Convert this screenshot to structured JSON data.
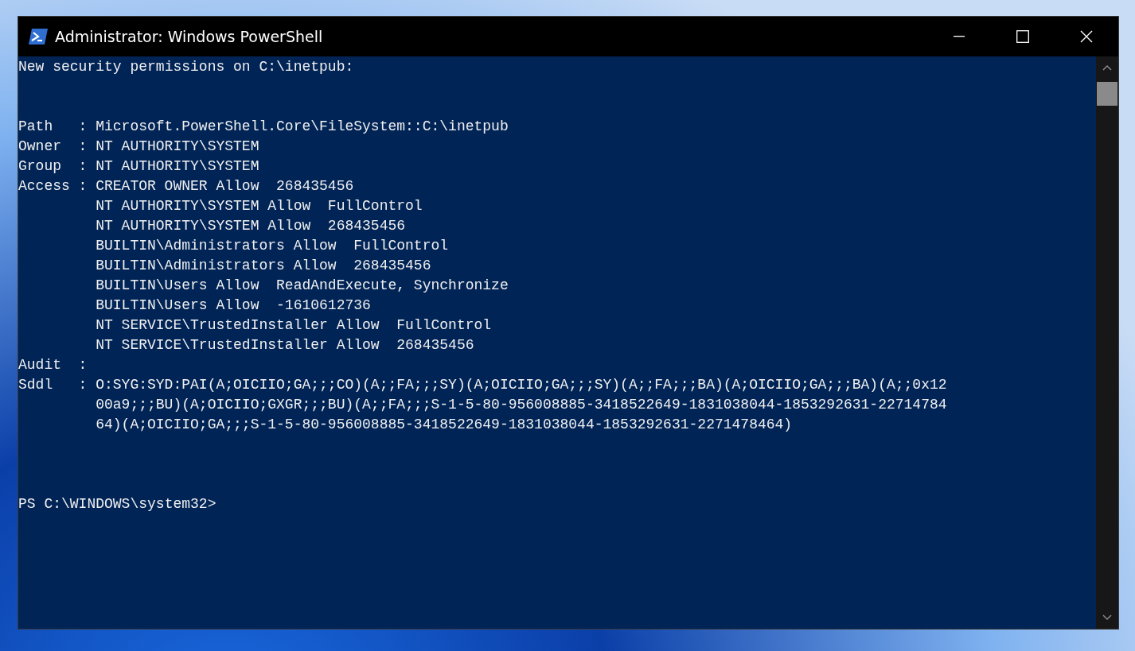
{
  "window": {
    "title": "Administrator: Windows PowerShell"
  },
  "console": {
    "heading": "New security permissions on C:\\inetpub:",
    "fields": [
      {
        "label": "Path   :",
        "lines": [
          "Microsoft.PowerShell.Core\\FileSystem::C:\\inetpub"
        ]
      },
      {
        "label": "Owner  :",
        "lines": [
          "NT AUTHORITY\\SYSTEM"
        ]
      },
      {
        "label": "Group  :",
        "lines": [
          "NT AUTHORITY\\SYSTEM"
        ]
      },
      {
        "label": "Access :",
        "lines": [
          "CREATOR OWNER Allow  268435456",
          "NT AUTHORITY\\SYSTEM Allow  FullControl",
          "NT AUTHORITY\\SYSTEM Allow  268435456",
          "BUILTIN\\Administrators Allow  FullControl",
          "BUILTIN\\Administrators Allow  268435456",
          "BUILTIN\\Users Allow  ReadAndExecute, Synchronize",
          "BUILTIN\\Users Allow  -1610612736",
          "NT SERVICE\\TrustedInstaller Allow  FullControl",
          "NT SERVICE\\TrustedInstaller Allow  268435456"
        ]
      },
      {
        "label": "Audit  :"
      },
      {
        "label": "Sddl   :",
        "lines": [
          "O:SYG:SYD:PAI(A;OICIIO;GA;;;CO)(A;;FA;;;SY)(A;OICIIO;GA;;;SY)(A;;FA;;;BA)(A;OICIIO;GA;;;BA)(A;;0x12",
          "00a9;;;BU)(A;OICIIO;GXGR;;;BU)(A;;FA;;;S-1-5-80-956008885-3418522649-1831038044-1853292631-22714784",
          "64)(A;OICIIO;GA;;;S-1-5-80-956008885-3418522649-1831038044-1853292631-2271478464)"
        ]
      }
    ],
    "prompt": "PS C:\\WINDOWS\\system32>"
  }
}
